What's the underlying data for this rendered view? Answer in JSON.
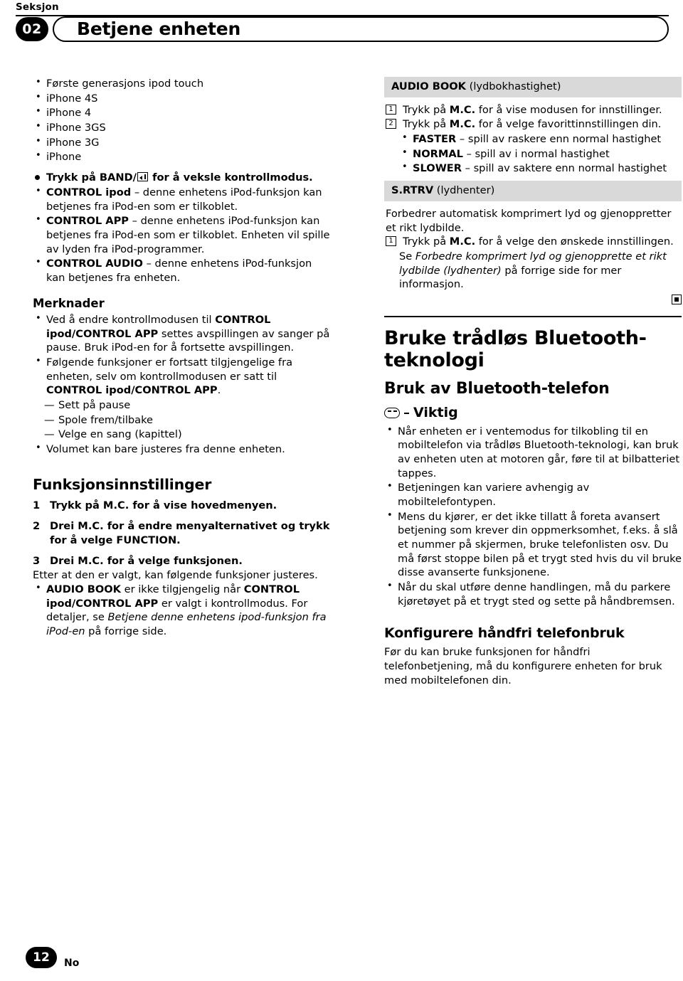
{
  "header": {
    "seksjon_label": "Seksjon",
    "chapter_number": "02",
    "chapter_title": "Betjene enheten"
  },
  "left": {
    "device_list": [
      "Første generasjons ipod touch",
      "iPhone 4S",
      "iPhone 4",
      "iPhone 3GS",
      "iPhone 3G",
      "iPhone"
    ],
    "band_item": {
      "pre": "Trykk på BAND/",
      "post": " for å veksle kontrollmodus."
    },
    "control_modes": [
      {
        "bold": "CONTROL ipod",
        "text": " – denne enhetens iPod-funksjon kan betjenes fra iPod-en som er tilkoblet."
      },
      {
        "bold": "CONTROL APP",
        "text": " – denne enhetens iPod-funksjon kan betjenes fra iPod-en som er tilkoblet. Enheten vil spille av lyden fra iPod-programmer."
      },
      {
        "bold": "CONTROL AUDIO",
        "text": " – denne enhetens iPod-funksjon kan betjenes fra enheten."
      }
    ],
    "merknader_head": "Merknader",
    "merknader": [
      {
        "parts": [
          {
            "text": "Ved å endre kontrollmodusen til ",
            "style": "normal"
          },
          {
            "text": "CONTROL ipod/CONTROL APP",
            "style": "bold"
          },
          {
            "text": " settes avspillingen av sanger på pause. Bruk iPod-en for å fortsette avspillingen.",
            "style": "normal"
          }
        ]
      },
      {
        "parts": [
          {
            "text": "Følgende funksjoner er fortsatt tilgjengelige fra enheten, selv om kontrollmodusen er satt til ",
            "style": "normal"
          },
          {
            "text": "CONTROL ipod/CONTROL APP",
            "style": "bold"
          },
          {
            "text": ".",
            "style": "normal"
          }
        ]
      }
    ],
    "dash_items": [
      "Sett på pause",
      "Spole frem/tilbake",
      "Velge en sang (kapittel)"
    ],
    "merknad_last": "Volumet kan bare justeres fra denne enheten.",
    "funksjon_head": "Funksjonsinnstillinger",
    "steps": [
      {
        "num": "1",
        "parts": [
          {
            "text": "Trykk på M.C. for å vise hovedmenyen.",
            "style": "bold"
          }
        ]
      },
      {
        "num": "2",
        "parts": [
          {
            "text": "Drei M.C. for å endre menyalternativet og trykk for å velge FUNCTION.",
            "style": "bold"
          }
        ]
      },
      {
        "num": "3",
        "parts": [
          {
            "text": "Drei M.C. for å velge funksjonen.",
            "style": "bold"
          }
        ]
      }
    ],
    "after_steps": "Etter at den er valgt, kan følgende funksjoner justeres.",
    "audio_book_note": {
      "parts": [
        {
          "text": "AUDIO BOOK",
          "style": "bold"
        },
        {
          "text": " er ikke tilgjengelig når ",
          "style": "normal"
        },
        {
          "text": "CONTROL ipod/CONTROL APP",
          "style": "bold"
        },
        {
          "text": " er valgt i kontrollmodus. For detaljer, se ",
          "style": "normal"
        },
        {
          "text": "Betjene denne enhetens ipod-funksjon fra iPod-en",
          "style": "italic"
        },
        {
          "text": " på forrige side.",
          "style": "normal"
        }
      ]
    }
  },
  "right": {
    "audio_book": {
      "name": "AUDIO BOOK",
      "desc": " (lydbokhastighet)",
      "steps": [
        {
          "marker": "1",
          "parts": [
            {
              "text": "Trykk på ",
              "style": "normal"
            },
            {
              "text": "M.C.",
              "style": "bold"
            },
            {
              "text": " for å vise modusen for innstillinger.",
              "style": "normal"
            }
          ]
        },
        {
          "marker": "2",
          "parts": [
            {
              "text": "Trykk på ",
              "style": "normal"
            },
            {
              "text": "M.C.",
              "style": "bold"
            },
            {
              "text": " for å velge favorittinnstillingen din.",
              "style": "normal"
            }
          ]
        }
      ],
      "options": [
        {
          "bold": "FASTER",
          "text": " – spill av raskere enn normal hastighet"
        },
        {
          "bold": "NORMAL",
          "text": " – spill av i normal hastighet"
        },
        {
          "bold": "SLOWER",
          "text": " – spill av saktere enn normal hastighet"
        }
      ]
    },
    "srtrv": {
      "name": "S.RTRV",
      "desc": " (lydhenter)",
      "intro": "Forbedrer automatisk komprimert lyd og gjenoppretter et rikt lydbilde.",
      "step": {
        "marker": "1",
        "parts": [
          {
            "text": "Trykk på ",
            "style": "normal"
          },
          {
            "text": "M.C.",
            "style": "bold"
          },
          {
            "text": " for å velge den ønskede innstillingen.",
            "style": "normal"
          }
        ]
      },
      "see_also": [
        {
          "text": "Se ",
          "style": "normal"
        },
        {
          "text": "Forbedre komprimert lyd og gjenopprette et rikt lydbilde (lydhenter)",
          "style": "italic"
        },
        {
          "text": " på forrige side for mer informasjon.",
          "style": "normal"
        }
      ]
    },
    "bluetooth": {
      "title": "Bruke trådløs Bluetooth-teknologi",
      "subtitle": "Bruk av Bluetooth-telefon",
      "viktig_label": "Viktig",
      "viktig_items": [
        "Når enheten er i ventemodus for tilkobling til en mobiltelefon via trådløs Bluetooth-teknologi, kan bruk av enheten uten at motoren går, føre til at bilbatteriet tappes.",
        "Betjeningen kan variere avhengig av mobiltelefontypen.",
        "Mens du kjører, er det ikke tillatt å foreta avansert betjening som krever din oppmerksomhet, f.eks. å slå et nummer på skjermen, bruke telefonlisten osv. Du må først stoppe bilen på et trygt sted hvis du vil bruke disse avanserte funksjonene.",
        "Når du skal utføre denne handlingen, må du parkere kjøretøyet på et trygt sted og sette på håndbremsen."
      ],
      "config_head": "Konfigurere håndfri telefonbruk",
      "config_text": "Før du kan bruke funksjonen for håndfri telefonbetjening, må du konfigurere enheten for bruk med mobiltelefonen din."
    }
  },
  "footer": {
    "page_number": "12",
    "language": "No"
  },
  "colors": {
    "grey_bar": "#d9d9d9",
    "ink": "#000000",
    "paper": "#ffffff"
  }
}
